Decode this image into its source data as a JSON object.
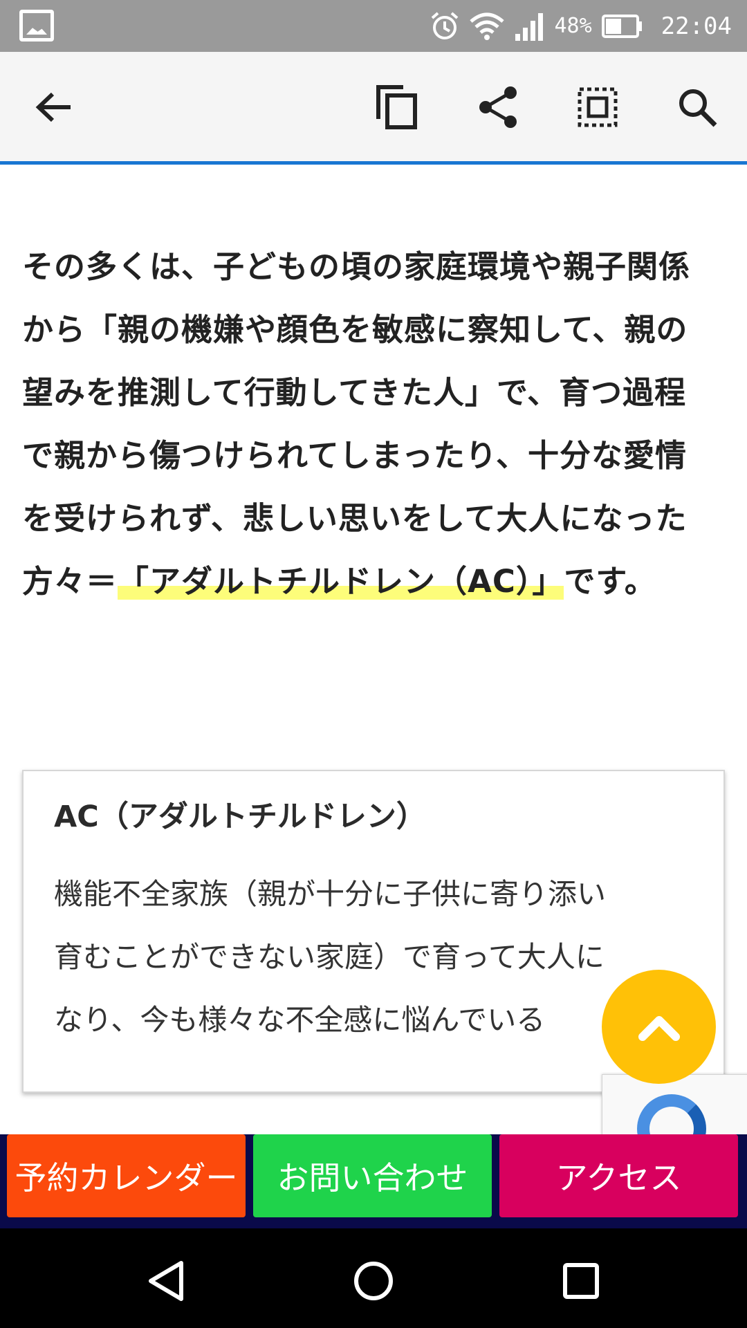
{
  "status_bar": {
    "battery_percent": "48%",
    "time": "22:04"
  },
  "toolbar": {
    "icons": [
      "back-arrow-icon",
      "copy-icon",
      "share-icon",
      "select-all-icon",
      "search-icon"
    ]
  },
  "article": {
    "paragraph_lines": [
      "その多くは、子どもの頃の家庭環境や親子関係",
      "から「親の機嫌や顔色を敏感に察知して、親の",
      "望みを推測して行動してきた人」で、育つ過程",
      "で親から傷つけられてしまったり、十分な愛情",
      "を受けられず、悲しい思いをして大人になった"
    ],
    "last_line_prefix": "方々＝",
    "highlight": "「アダルトチルドレン（AC）」",
    "last_line_suffix": "です。"
  },
  "card": {
    "title": "AC（アダルトチルドレン）",
    "body_lines": [
      "機能不全家族（親が十分に子供に寄り添い",
      "育むことができない家庭）で育って大人に",
      "なり、今も様々な不全感に悩んでいる"
    ]
  },
  "bottom_nav": {
    "reserve_label": "予約カレンダー",
    "contact_label": "お問い合わせ",
    "access_label": "アクセス"
  },
  "colors": {
    "accent_line": "#1976d2",
    "highlight": "#fdfd7a",
    "scroll_top": "#ffc107",
    "reserve": "#fc4a0c",
    "contact": "#1fd34b",
    "access": "#d8005e"
  }
}
